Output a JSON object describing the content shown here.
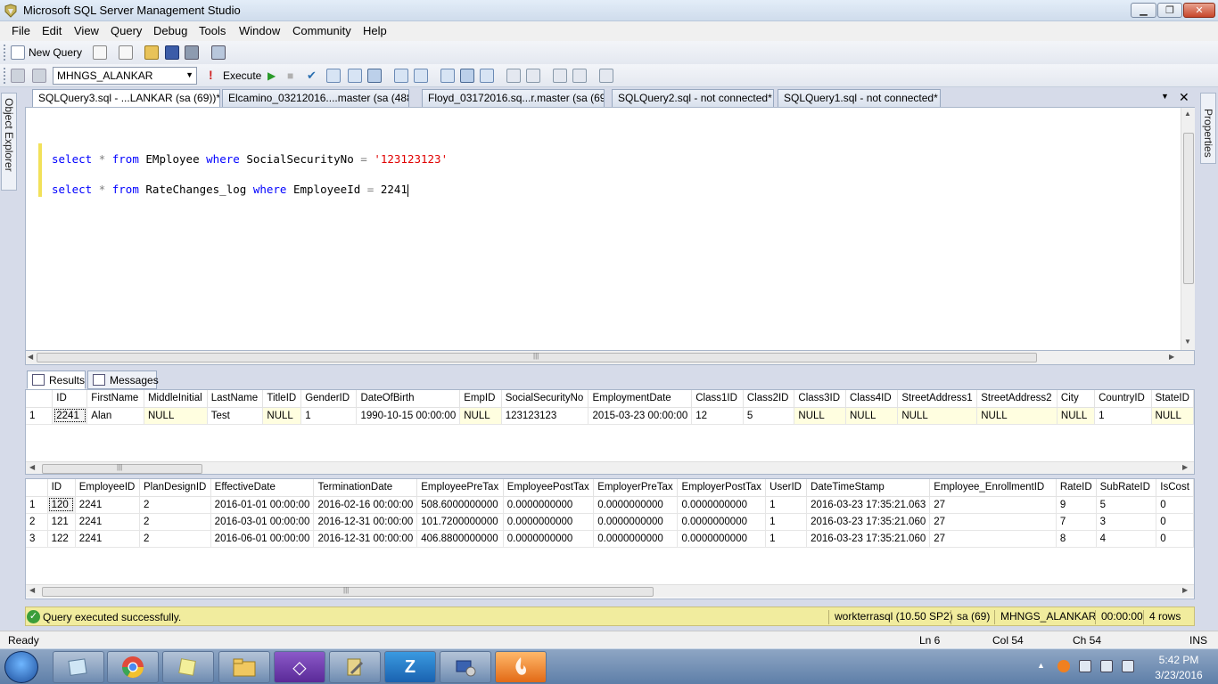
{
  "window": {
    "title": "Microsoft SQL Server Management Studio",
    "min_glyph": "▁",
    "max_glyph": "❐",
    "close_glyph": "✕"
  },
  "menu": [
    "File",
    "Edit",
    "View",
    "Query",
    "Debug",
    "Tools",
    "Window",
    "Community",
    "Help"
  ],
  "toolbar": {
    "new_query_label": "New Query",
    "database": "MHNGS_ALANKAR",
    "execute_label": "Execute",
    "execute_glyph": "!",
    "play_glyph": "▶",
    "stop_glyph": "■",
    "check_glyph": "✔"
  },
  "side_panels": {
    "left_label": "Object Explorer",
    "right_label": "Properties"
  },
  "doc_tabs": [
    "SQLQuery3.sql - ...LANKAR (sa (69))*",
    "Elcamino_03212016....master (sa (488))",
    "Floyd_03172016.sq...r.master (sa (69))",
    "SQLQuery2.sql - not connected*",
    "SQLQuery1.sql - not connected*"
  ],
  "tab_controls": {
    "menu_glyph": "▼",
    "close_glyph": "✕"
  },
  "editor": {
    "line1": {
      "k1": "select",
      "op1": "*",
      "k2": "from",
      "t1": "EMployee",
      "k3": "where",
      "t2": "SocialSecurityNo",
      "op2": "=",
      "s1": "'123123123'"
    },
    "line2": {
      "k1": "select",
      "op1": "*",
      "k2": "from",
      "t1": "RateChanges_log",
      "k3": "where",
      "t2": "EmployeeId",
      "op2": "=",
      "n1": "2241"
    }
  },
  "results_tabs": {
    "results": "Results",
    "messages": "Messages"
  },
  "grid1": {
    "columns": [
      "",
      "ID",
      "FirstName",
      "MiddleInitial",
      "LastName",
      "TitleID",
      "GenderID",
      "DateOfBirth",
      "EmpID",
      "SocialSecurityNo",
      "EmploymentDate",
      "Class1ID",
      "Class2ID",
      "Class3ID",
      "Class4ID",
      "StreetAddress1",
      "StreetAddress2",
      "City",
      "CountryID",
      "StateID"
    ],
    "rows": [
      [
        "1",
        "2241",
        "Alan",
        "NULL",
        "Test",
        "NULL",
        "1",
        "1990-10-15 00:00:00",
        "NULL",
        "123123123",
        "2015-03-23 00:00:00",
        "12",
        "5",
        "NULL",
        "NULL",
        "NULL",
        "NULL",
        "NULL",
        "1",
        "NULL"
      ]
    ]
  },
  "grid2": {
    "columns": [
      "",
      "ID",
      "EmployeeID",
      "PlanDesignID",
      "EffectiveDate",
      "TerminationDate",
      "EmployeePreTax",
      "EmployeePostTax",
      "EmployerPreTax",
      "EmployerPostTax",
      "UserID",
      "DateTimeStamp",
      "Employee_EnrollmentID",
      "RateID",
      "SubRateID",
      "IsCost"
    ],
    "rows": [
      [
        "1",
        "120",
        "2241",
        "2",
        "2016-01-01 00:00:00",
        "2016-02-16 00:00:00",
        "508.6000000000",
        "0.0000000000",
        "0.0000000000",
        "0.0000000000",
        "1",
        "2016-03-23 17:35:21.063",
        "27",
        "9",
        "5",
        "0"
      ],
      [
        "2",
        "121",
        "2241",
        "2",
        "2016-03-01 00:00:00",
        "2016-12-31 00:00:00",
        "101.7200000000",
        "0.0000000000",
        "0.0000000000",
        "0.0000000000",
        "1",
        "2016-03-23 17:35:21.060",
        "27",
        "7",
        "3",
        "0"
      ],
      [
        "3",
        "122",
        "2241",
        "2",
        "2016-06-01 00:00:00",
        "2016-12-31 00:00:00",
        "406.8800000000",
        "0.0000000000",
        "0.0000000000",
        "0.0000000000",
        "1",
        "2016-03-23 17:35:21.060",
        "27",
        "8",
        "4",
        "0"
      ]
    ]
  },
  "query_status": {
    "ok_glyph": "✓",
    "message": "Query executed successfully.",
    "server": "workterrasql (10.50 SP2)",
    "user": "sa (69)",
    "database": "MHNGS_ALANKAR",
    "elapsed": "00:00:00",
    "rows": "4 rows"
  },
  "app_status": {
    "ready": "Ready",
    "ln": "Ln 6",
    "col": "Col 54",
    "ch": "Ch 54",
    "mode": "INS"
  },
  "taskbar": {
    "zapp_glyph": "Z",
    "vs_glyph": "◇",
    "time": "5:42 PM",
    "date": "3/23/2016",
    "tray_arrow": "▲"
  },
  "scroll_glyphs": {
    "left": "◀",
    "right": "▶",
    "up": "▲",
    "down": "▼",
    "grip": "|||"
  },
  "colors": {
    "keyword": "#0000ff",
    "string": "#e00000",
    "null_cell": "#fffee0",
    "status_bar": "#f1ec9e"
  }
}
